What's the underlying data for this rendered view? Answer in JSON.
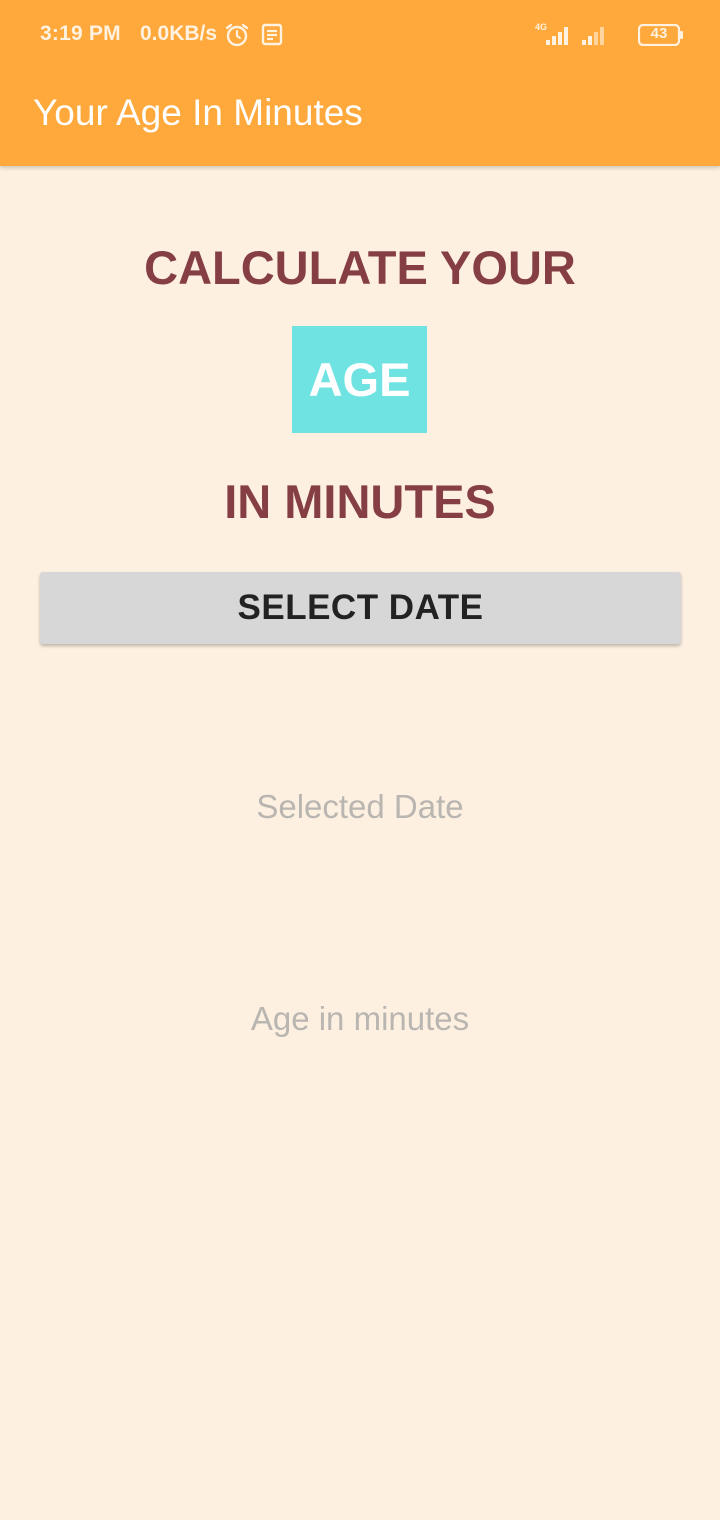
{
  "status_bar": {
    "time": "3:19 PM",
    "net_speed": "0.0KB/s",
    "alarm_icon": "alarm-clock-icon",
    "notification_icon": "news-icon",
    "network_label": "4G",
    "battery": "43"
  },
  "app_bar": {
    "title": "Your Age In Minutes",
    "color": "#FFA83B"
  },
  "main": {
    "heading_line1": "CALCULATE YOUR",
    "heading_highlight": "AGE",
    "heading_line2": "IN MINUTES",
    "select_button_label": "SELECT DATE",
    "selected_date_placeholder": "Selected Date",
    "age_minutes_placeholder": "Age in minutes"
  },
  "colors": {
    "background": "#FDF0E1",
    "heading_text": "#863E45",
    "highlight_box": "#6FE3E2",
    "button_bg": "#D7D7D7",
    "hint_text": "#B9B5B0"
  }
}
